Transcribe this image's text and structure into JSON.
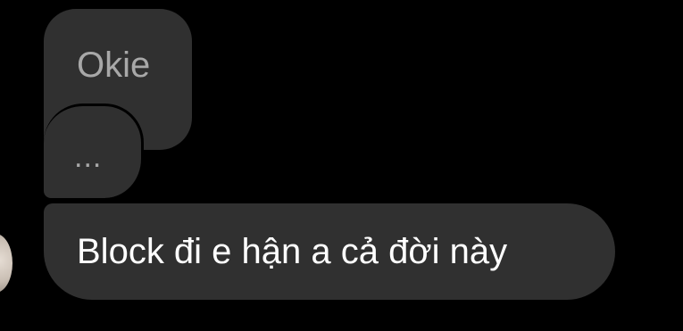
{
  "conversation": {
    "messages": [
      {
        "sender": "other",
        "text": "Okie"
      },
      {
        "sender": "other",
        "text": "..."
      },
      {
        "sender": "other",
        "text": "Block đi e hận a cả đời này"
      }
    ]
  },
  "colors": {
    "background": "#000000",
    "bubble": "#303030",
    "text_primary": "#ffffff",
    "text_muted": "#a8a8a8"
  },
  "icons": {
    "avatar": "sender-avatar"
  }
}
